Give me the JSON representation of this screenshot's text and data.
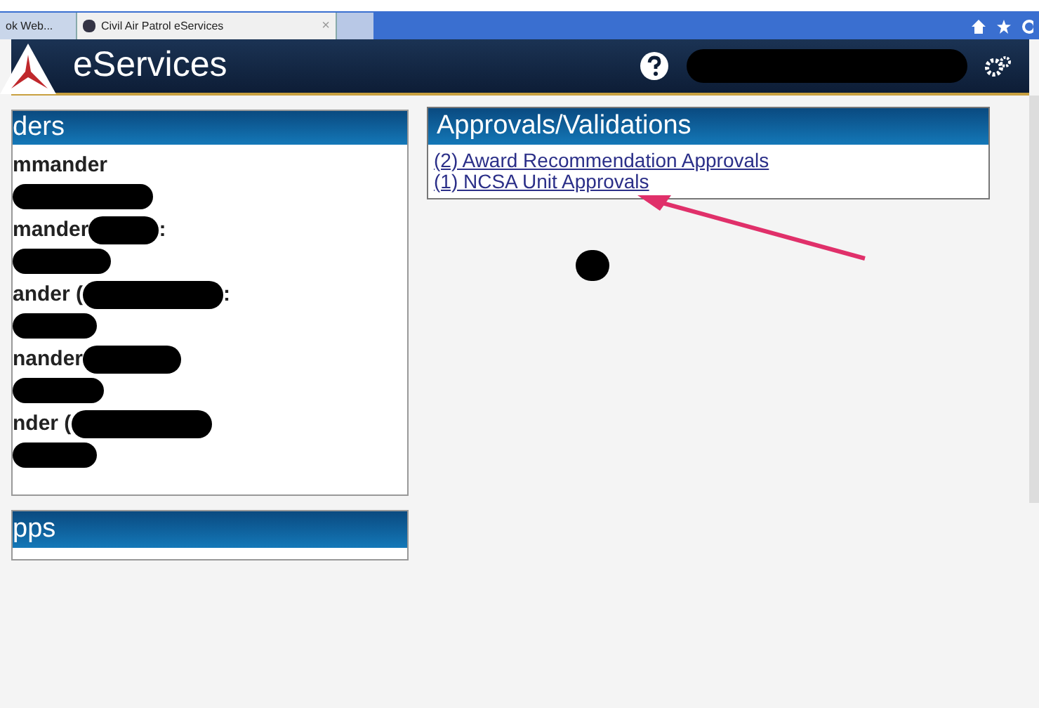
{
  "browser": {
    "tabs": [
      {
        "label": "ok Web...",
        "selected": false
      },
      {
        "label": "Civil Air Patrol eServices",
        "selected": true,
        "close": "×"
      }
    ]
  },
  "header": {
    "title": "eServices"
  },
  "commanders_panel": {
    "title": "ders",
    "items": [
      {
        "label": "mmander"
      },
      {
        "label": "mander",
        "suffix": ":"
      },
      {
        "label": "ander (",
        "suffix": ":"
      },
      {
        "label": "nander"
      },
      {
        "label": "nder ("
      }
    ]
  },
  "apps_panel": {
    "title": "pps"
  },
  "approvals_panel": {
    "title": "Approvals/Validations",
    "links": [
      "(2) Award Recommendation Approvals",
      "(1) NCSA Unit Approvals"
    ]
  }
}
